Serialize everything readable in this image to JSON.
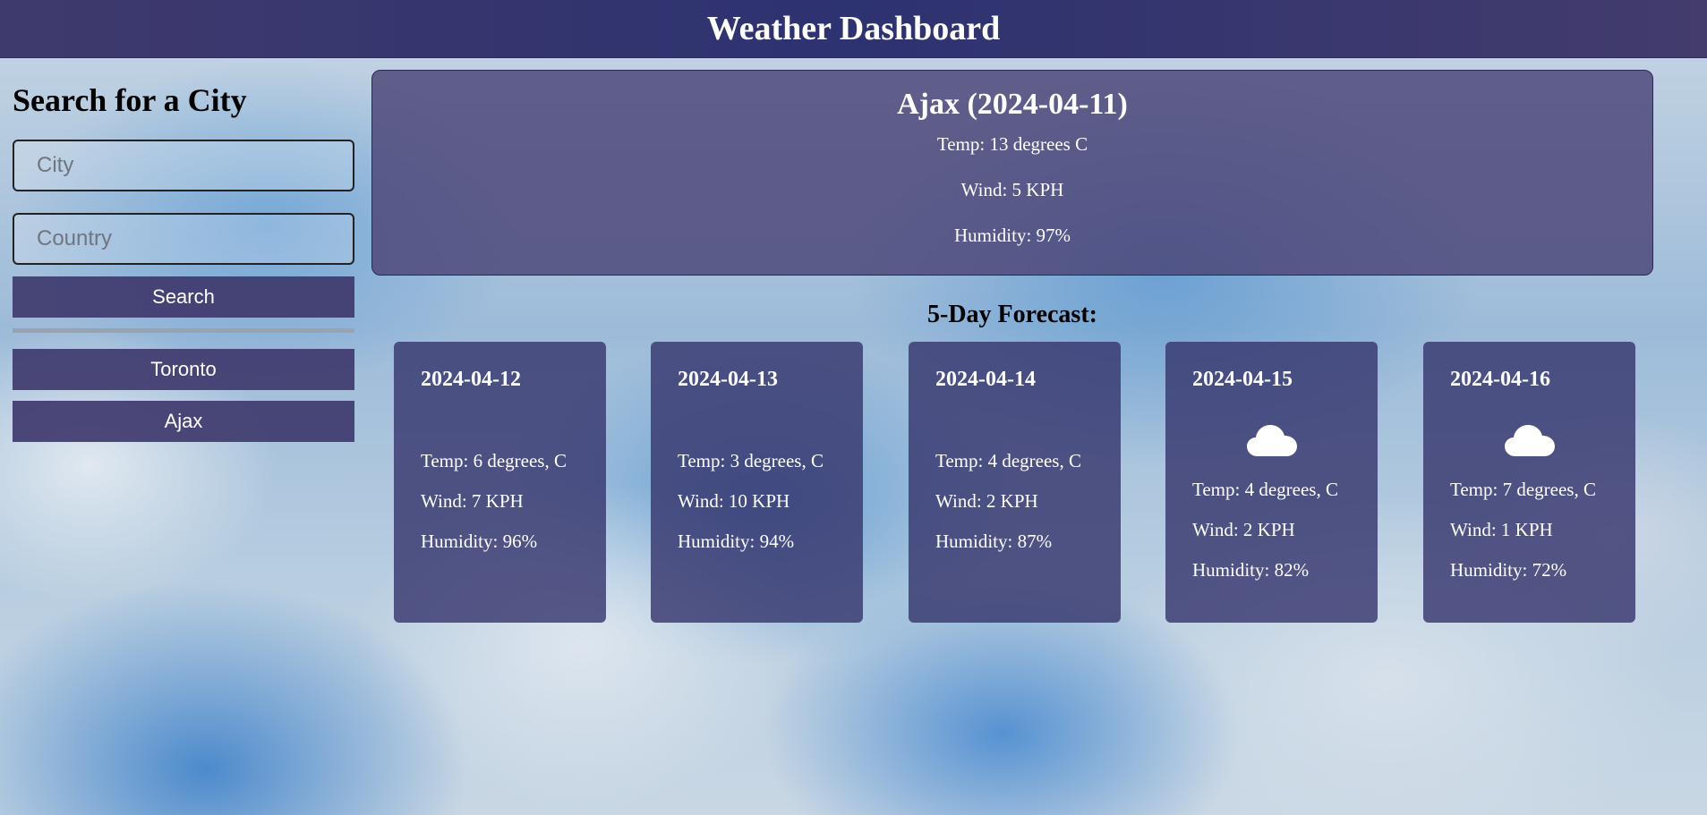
{
  "header": {
    "title": "Weather Dashboard"
  },
  "sidebar": {
    "title": "Search for a City",
    "city_placeholder": "City",
    "city_value": "",
    "country_placeholder": "Country",
    "country_value": "",
    "search_label": "Search",
    "history": [
      "Toronto",
      "Ajax"
    ]
  },
  "current": {
    "title": "Ajax (2024-04-11)",
    "temp": "Temp: 13 degrees C",
    "wind": "Wind: 5 KPH",
    "humidity": "Humidity: 97%"
  },
  "forecast": {
    "title": "5-Day Forecast:",
    "days": [
      {
        "date": "2024-04-12",
        "icon": "",
        "temp": "Temp: 6 degrees, C",
        "wind": "Wind: 7 KPH",
        "humidity": "Humidity: 96%"
      },
      {
        "date": "2024-04-13",
        "icon": "",
        "temp": "Temp: 3 degrees, C",
        "wind": "Wind: 10 KPH",
        "humidity": "Humidity: 94%"
      },
      {
        "date": "2024-04-14",
        "icon": "",
        "temp": "Temp: 4 degrees, C",
        "wind": "Wind: 2 KPH",
        "humidity": "Humidity: 87%"
      },
      {
        "date": "2024-04-15",
        "icon": "cloud-icon",
        "temp": "Temp: 4 degrees, C",
        "wind": "Wind: 2 KPH",
        "humidity": "Humidity: 82%"
      },
      {
        "date": "2024-04-16",
        "icon": "cloud-icon",
        "temp": "Temp: 7 degrees, C",
        "wind": "Wind: 1 KPH",
        "humidity": "Humidity: 72%"
      }
    ]
  },
  "colors": {
    "header_bg": "#3f3a6d",
    "panel_bg": "#4b4476",
    "card_bg": "#37376e",
    "button_bg": "#3f3a6e",
    "text_light": "#ffffff"
  }
}
